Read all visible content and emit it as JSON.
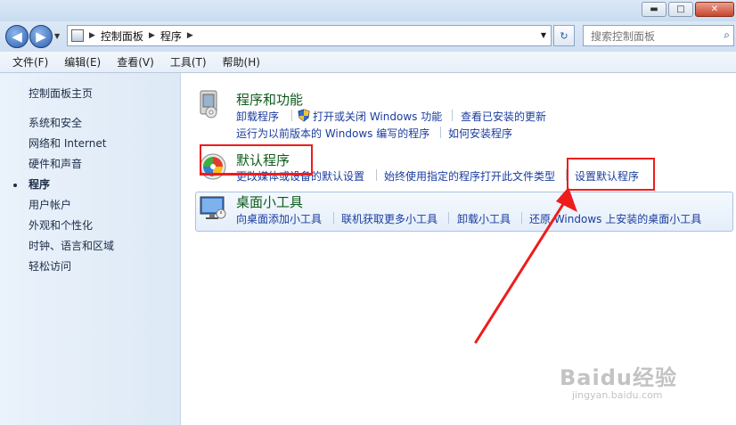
{
  "window": {
    "minimize_glyph": "▬",
    "maximize_glyph": "□",
    "close_glyph": "✕"
  },
  "nav": {
    "back_glyph": "◀",
    "forward_glyph": "▶",
    "breadcrumb": [
      "控制面板",
      "程序"
    ],
    "refresh_glyph": "↻",
    "search_placeholder": "搜索控制面板",
    "search_glyph": "⌕"
  },
  "menu": [
    "文件(F)",
    "编辑(E)",
    "查看(V)",
    "工具(T)",
    "帮助(H)"
  ],
  "sidebar": {
    "home": "控制面板主页",
    "items": [
      "系统和安全",
      "网络和 Internet",
      "硬件和声音",
      "程序",
      "用户帐户",
      "外观和个性化",
      "时钟、语言和区域",
      "轻松访问"
    ],
    "current": "程序"
  },
  "categories": {
    "programs": {
      "title": "程序和功能",
      "links": [
        "卸载程序",
        "打开或关闭 Windows 功能",
        "查看已安装的更新",
        "运行为以前版本的 Windows 编写的程序",
        "如何安装程序"
      ]
    },
    "defaults": {
      "title": "默认程序",
      "links": [
        "更改媒体或设备的默认设置",
        "始终使用指定的程序打开此文件类型",
        "设置默认程序"
      ]
    },
    "gadgets": {
      "title": "桌面小工具",
      "links": [
        "向桌面添加小工具",
        "联机获取更多小工具",
        "卸载小工具",
        "还原 Windows 上安装的桌面小工具"
      ]
    }
  },
  "watermark": {
    "brand": "Baidu经验",
    "url": "jingyan.baidu.com"
  },
  "colors": {
    "link": "#1a3c9e",
    "title": "#0e5b1b",
    "highlight": "#ef1c1c"
  }
}
